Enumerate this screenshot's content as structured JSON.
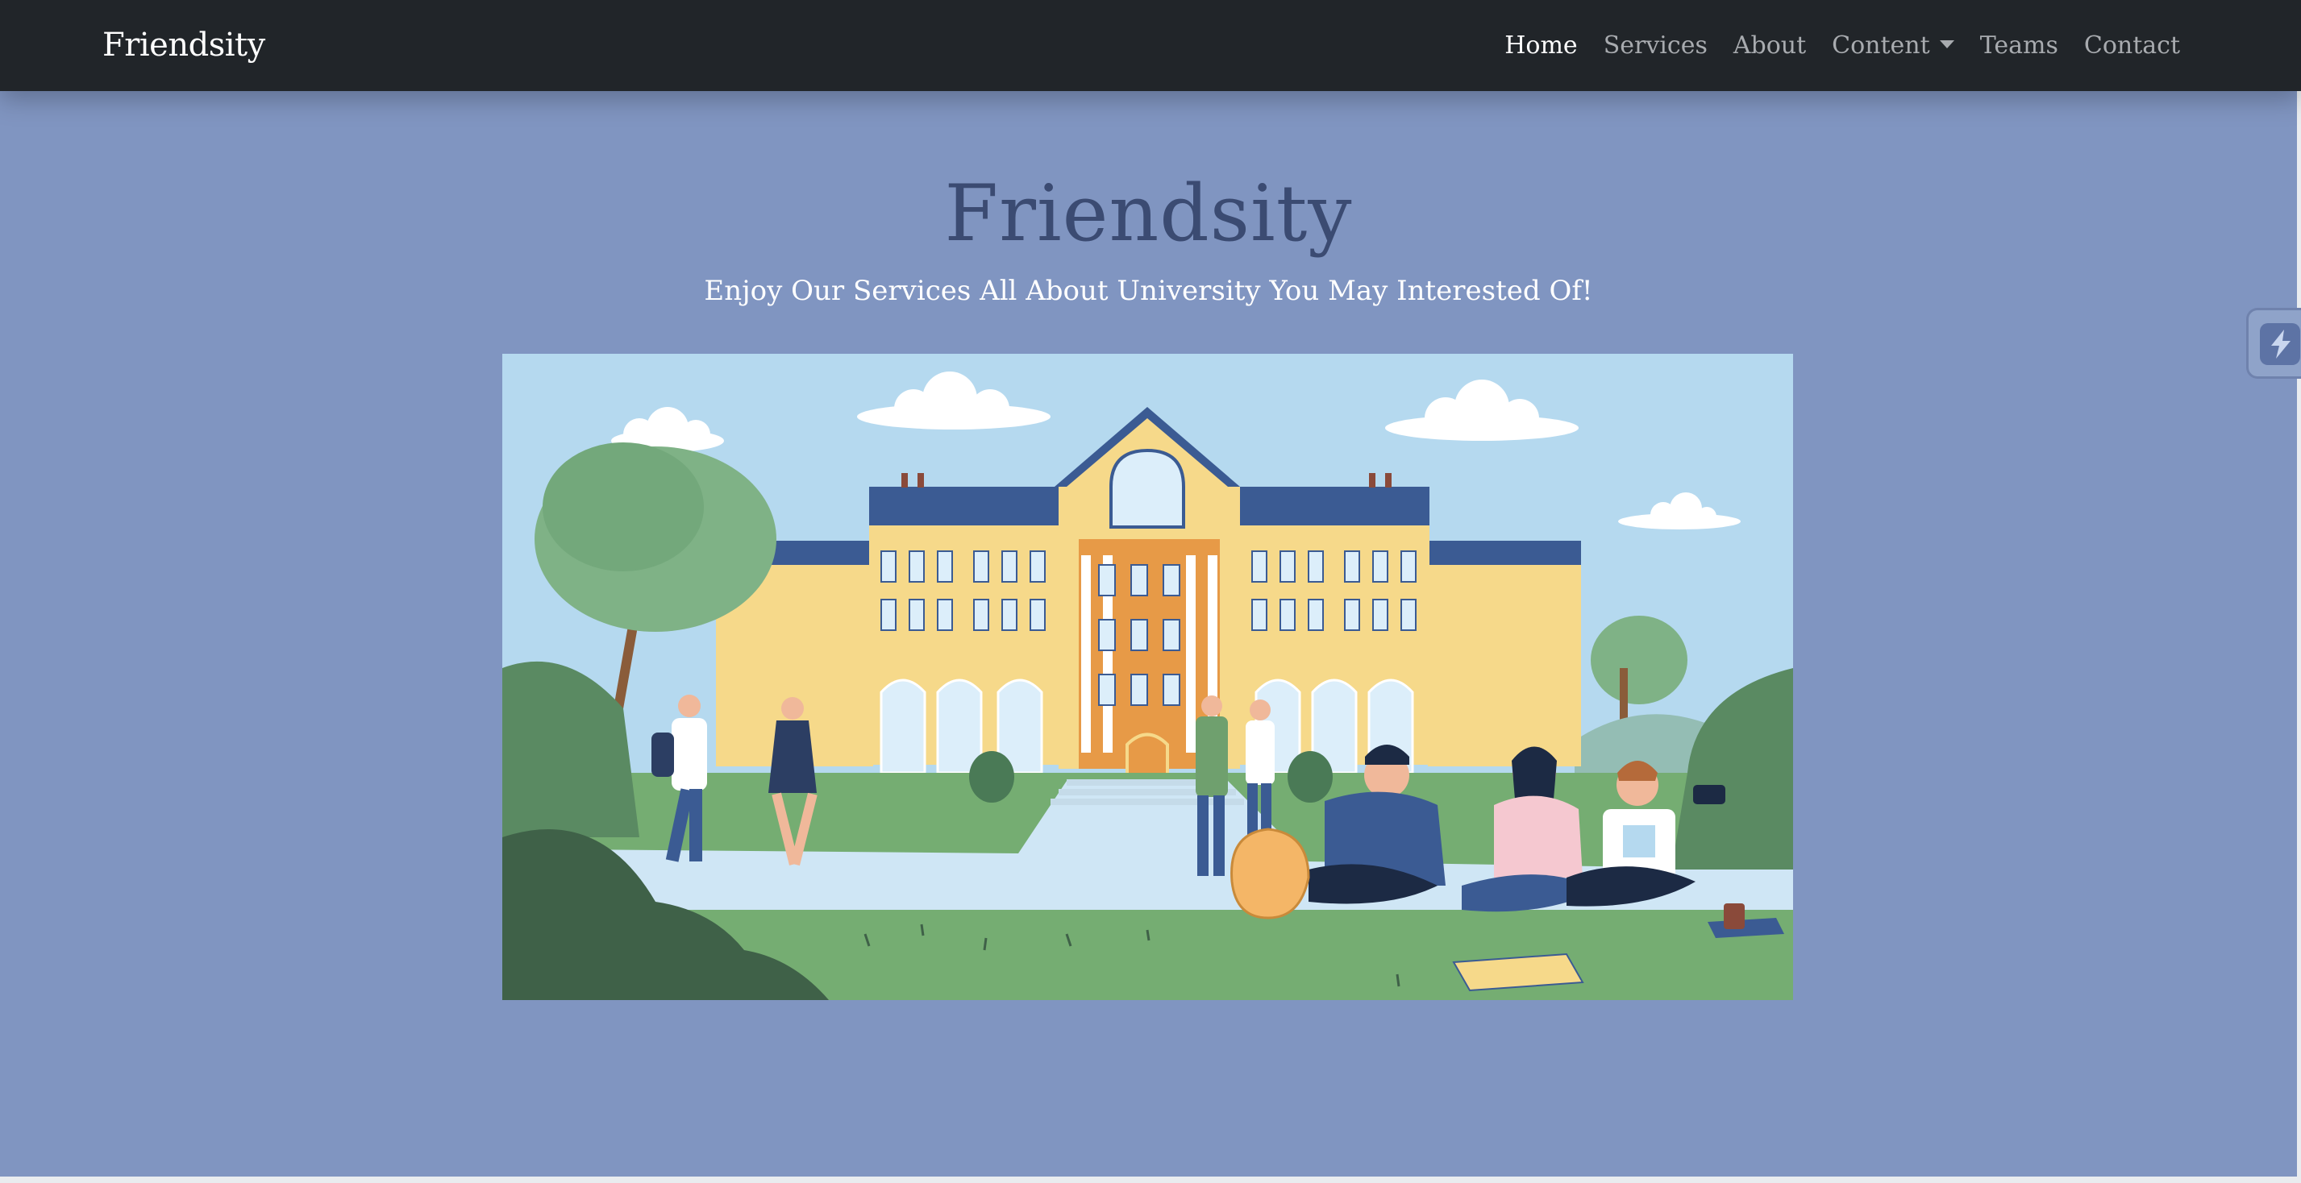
{
  "navbar": {
    "brand": "Friendsity",
    "links": [
      {
        "label": "Home",
        "active": true
      },
      {
        "label": "Services"
      },
      {
        "label": "About"
      },
      {
        "label": "Content",
        "dropdown": true
      },
      {
        "label": "Teams"
      },
      {
        "label": "Contact"
      }
    ]
  },
  "hero": {
    "title": "Friendsity",
    "subtitle": "Enjoy Our Services All About University You May Interested Of!",
    "image_icon": "university-campus-illustration"
  },
  "side_widget": {
    "icon": "lightning-bolt-icon"
  },
  "colors": {
    "navbar_bg": "#212529",
    "page_bg": "#8095c1",
    "title_color": "#3b4b72",
    "nav_active": "#ffffff",
    "nav_inactive": "#a8abaf"
  }
}
